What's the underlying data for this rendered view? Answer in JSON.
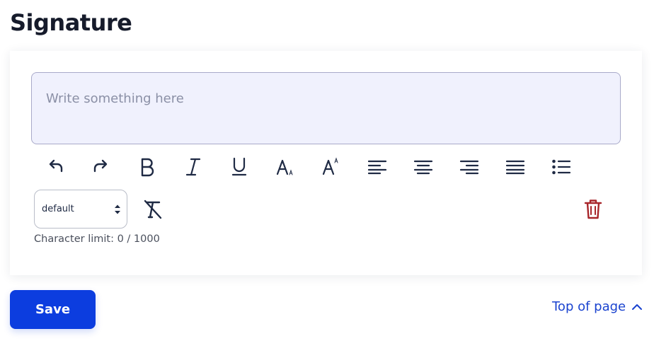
{
  "section": {
    "title": "Signature"
  },
  "editor": {
    "placeholder": "Write something here"
  },
  "toolbar": {
    "icons": [
      "undo-icon",
      "redo-icon",
      "bold-icon",
      "italic-icon",
      "underline-icon",
      "font-size-decrease-icon",
      "font-size-increase-icon",
      "align-left-icon",
      "align-center-icon",
      "align-right-icon",
      "align-justify-icon",
      "bullet-list-icon"
    ],
    "font_select_value": "default",
    "clear_format_icon": "clear-formatting-icon",
    "delete_icon": "trash-icon"
  },
  "character_limit": {
    "text": "Character limit: 0 / 1000",
    "current": 0,
    "max": 1000
  },
  "actions": {
    "save_label": "Save",
    "top_of_page_label": "Top of page"
  },
  "colors": {
    "primary": "#0c3ddf",
    "link": "#1a43cf",
    "editor_bg": "#f0f1fd",
    "icon": "#1f2a44",
    "danger": "#a8262b"
  }
}
